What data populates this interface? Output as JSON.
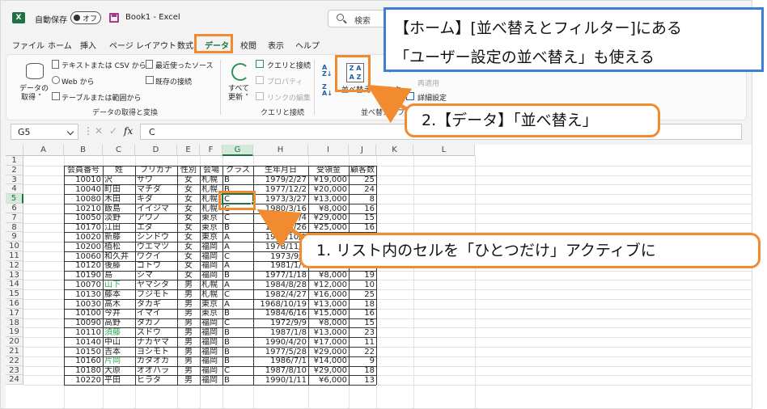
{
  "titlebar": {
    "app_icon": "excel-icon",
    "autosave_label": "自動保存",
    "autosave_state": "オフ",
    "doc_title": "Book1  -  Excel",
    "search_placeholder": "検索"
  },
  "menu_tabs": [
    {
      "label": "ファイル",
      "active": false
    },
    {
      "label": "ホーム",
      "active": false
    },
    {
      "label": "挿入",
      "active": false
    },
    {
      "label": "ページ レイアウト",
      "active": false
    },
    {
      "label": "数式",
      "active": false
    },
    {
      "label": "データ",
      "active": true
    },
    {
      "label": "校閲",
      "active": false
    },
    {
      "label": "表示",
      "active": false
    },
    {
      "label": "ヘルプ",
      "active": false
    }
  ],
  "ribbon": {
    "get_data_label_1": "データの",
    "get_data_label_2": "取得 ˅",
    "from_text_csv": "テキストまたは CSV から",
    "from_web": "Web から",
    "from_table": "テーブルまたは範囲から",
    "recent_sources": "最近使ったソース",
    "existing_connections": "既存の接続",
    "group_get_transform": "データの取得と変換",
    "refresh_all_1": "すべて",
    "refresh_all_2": "更新 ˅",
    "queries_connections": "クエリと接続",
    "properties": "プロパティ",
    "edit_links": "リンクの編集",
    "group_queries": "クエリと接続",
    "sort_button": "並べ替え",
    "filter_button": "フィルター",
    "reapply": "再適用",
    "advanced": "詳細設定",
    "group_sort_filter": "並べ替えとフィル"
  },
  "formula_bar": {
    "name_box": "G5",
    "formula": "C",
    "cancel_glyph": "✕",
    "ok_glyph": "✓",
    "fx_glyph": "fx",
    "dots": "⋮"
  },
  "sheet": {
    "columns": [
      "A",
      "B",
      "C",
      "D",
      "E",
      "F",
      "G",
      "H",
      "I",
      "J",
      "K",
      "L"
    ],
    "rows": [
      "1",
      "2",
      "3",
      "4",
      "5",
      "6",
      "7",
      "8",
      "9",
      "10",
      "11",
      "12",
      "13",
      "14",
      "15",
      "16",
      "17",
      "18",
      "19",
      "20",
      "21",
      "22",
      "23",
      "24"
    ],
    "headers": [
      "会員番号",
      "姓",
      "フリガナ",
      "性別",
      "会場",
      "クラス",
      "生年月日",
      "受領金",
      "顧客数"
    ],
    "data": [
      [
        "10010",
        "沢",
        "サワ",
        "女",
        "札幌",
        "B",
        "1979/2/27",
        "¥19,000",
        "25"
      ],
      [
        "10040",
        "町田",
        "マチダ",
        "女",
        "札幌",
        "B",
        "1977/12/2",
        "¥20,000",
        "24"
      ],
      [
        "10080",
        "木田",
        "キダ",
        "女",
        "札幌",
        "C",
        "1973/3/27",
        "¥13,000",
        "8"
      ],
      [
        "10210",
        "飯島",
        "イイジマ",
        "女",
        "札幌",
        "C",
        "1980/3/16",
        "¥8,000",
        "16"
      ],
      [
        "10050",
        "淡野",
        "アワノ",
        "女",
        "東京",
        "C",
        "1978/8/4",
        "¥29,000",
        "15"
      ],
      [
        "10170",
        "江田",
        "エダ",
        "女",
        "東京",
        "B",
        "1974/3/26",
        "¥25,000",
        "16"
      ],
      [
        "10020",
        "新藤",
        "シンドウ",
        "女",
        "東京",
        "A",
        "1971/10/1",
        "¥10,000",
        "10"
      ],
      [
        "10200",
        "植松",
        "ウエマツ",
        "女",
        "福岡",
        "A",
        "1978/11/3",
        "¥14,000",
        "11"
      ],
      [
        "10060",
        "和久井",
        "ワクイ",
        "女",
        "福岡",
        "C",
        "1973/9/2",
        "¥21,000",
        "10"
      ],
      [
        "10120",
        "後藤",
        "ゴトウ",
        "女",
        "福岡",
        "A",
        "1981/1/7",
        "¥17,000",
        "12"
      ],
      [
        "10190",
        "島",
        "シマ",
        "女",
        "福岡",
        "B",
        "1977/1/18",
        "¥8,000",
        "19"
      ],
      [
        "10070",
        "山下",
        "ヤマシタ",
        "男",
        "札幌",
        "A",
        "1984/8/28",
        "¥12,000",
        "10"
      ],
      [
        "10130",
        "藤本",
        "フジモト",
        "男",
        "札幌",
        "C",
        "1982/4/27",
        "¥16,000",
        "25"
      ],
      [
        "10030",
        "高木",
        "タカギ",
        "男",
        "東京",
        "A",
        "1968/10/19",
        "¥13,000",
        "18"
      ],
      [
        "10100",
        "今井",
        "イマイ",
        "男",
        "東京",
        "B",
        "1984/6/16",
        "¥15,000",
        "16"
      ],
      [
        "10090",
        "高野",
        "タカノ",
        "男",
        "福岡",
        "C",
        "1972/9/9",
        "¥8,000",
        "15"
      ],
      [
        "10110",
        "須藤",
        "スドウ",
        "男",
        "福岡",
        "B",
        "1987/1/8",
        "¥13,000",
        "23"
      ],
      [
        "10140",
        "中山",
        "ナカヤマ",
        "男",
        "福岡",
        "B",
        "1990/4/20",
        "¥17,000",
        "11"
      ],
      [
        "10150",
        "吉本",
        "ヨシモト",
        "男",
        "福岡",
        "B",
        "1977/5/28",
        "¥29,000",
        "22"
      ],
      [
        "10160",
        "片岡",
        "カタオカ",
        "男",
        "福岡",
        "B",
        "1986/7/1",
        "¥14,000",
        "9"
      ],
      [
        "10180",
        "大原",
        "オオハラ",
        "男",
        "福岡",
        "C",
        "1987/8/10",
        "¥29,000",
        "18"
      ],
      [
        "10220",
        "平田",
        "ヒラタ",
        "男",
        "福岡",
        "B",
        "1990/1/11",
        "¥6,000",
        "13"
      ]
    ],
    "green_surnames": [
      "山下",
      "須藤",
      "片岡"
    ],
    "active_cell": "G5"
  },
  "annotations": {
    "home_note_line1": "【ホーム】[並べ替えとフィルター]にある",
    "home_note_line2": "「ユーザー設定の並べ替え」も使える",
    "step2": "2.【データ】「並べ替え」",
    "step1": "1. リスト内のセルを「ひとつだけ」アクティブに"
  },
  "colors": {
    "excel_green": "#1f7244",
    "annotation_orange": "#f28b2f",
    "annotation_blue": "#3d7fd6",
    "green_text": "#2fa84f"
  }
}
